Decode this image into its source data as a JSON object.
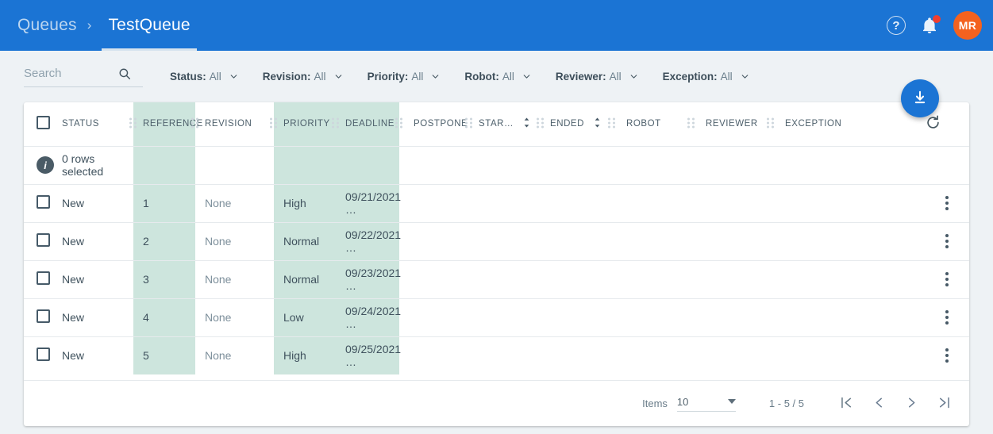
{
  "appbar": {
    "breadcrumb_root": "Queues",
    "breadcrumb_separator": "›",
    "breadcrumb_active": "TestQueue",
    "help_label": "?",
    "avatar_initials": "MR",
    "brand_color": "#1b74d4",
    "avatar_color": "#f4621f",
    "badge_color": "#f03e2f"
  },
  "filters": {
    "search_placeholder": "Search",
    "search_value": "",
    "items": [
      {
        "label": "Status:",
        "value": "All"
      },
      {
        "label": "Revision:",
        "value": "All"
      },
      {
        "label": "Priority:",
        "value": "All"
      },
      {
        "label": "Robot:",
        "value": "All"
      },
      {
        "label": "Reviewer:",
        "value": "All"
      },
      {
        "label": "Exception:",
        "value": "All"
      }
    ]
  },
  "table": {
    "highlight_color": "#cde5dd",
    "columns": [
      {
        "key": "status",
        "label": "STATUS",
        "highlight": false,
        "sortable": false
      },
      {
        "key": "reference",
        "label": "REFERENCE",
        "highlight": true,
        "sortable": false
      },
      {
        "key": "revision",
        "label": "REVISION",
        "highlight": false,
        "sortable": false
      },
      {
        "key": "priority",
        "label": "PRIORITY",
        "highlight": true,
        "sortable": false
      },
      {
        "key": "deadline",
        "label": "DEADLINE",
        "highlight": true,
        "sortable": false
      },
      {
        "key": "postpone",
        "label": "POSTPONE",
        "highlight": false,
        "sortable": false
      },
      {
        "key": "started",
        "label": "STAR…",
        "highlight": false,
        "sortable": true
      },
      {
        "key": "ended",
        "label": "ENDED",
        "highlight": false,
        "sortable": true
      },
      {
        "key": "robot",
        "label": "ROBOT",
        "highlight": false,
        "sortable": false
      },
      {
        "key": "reviewer",
        "label": "REVIEWER",
        "highlight": false,
        "sortable": false
      },
      {
        "key": "exception",
        "label": "EXCEPTION",
        "highlight": false,
        "sortable": false
      }
    ],
    "selection_info": "0 rows selected",
    "rows": [
      {
        "status": "New",
        "reference": "1",
        "revision": "None",
        "priority": "High",
        "deadline": "09/21/2021 …",
        "postpone": "",
        "started": "",
        "ended": "",
        "robot": "",
        "reviewer": "",
        "exception": ""
      },
      {
        "status": "New",
        "reference": "2",
        "revision": "None",
        "priority": "Normal",
        "deadline": "09/22/2021 …",
        "postpone": "",
        "started": "",
        "ended": "",
        "robot": "",
        "reviewer": "",
        "exception": ""
      },
      {
        "status": "New",
        "reference": "3",
        "revision": "None",
        "priority": "Normal",
        "deadline": "09/23/2021 …",
        "postpone": "",
        "started": "",
        "ended": "",
        "robot": "",
        "reviewer": "",
        "exception": ""
      },
      {
        "status": "New",
        "reference": "4",
        "revision": "None",
        "priority": "Low",
        "deadline": "09/24/2021 …",
        "postpone": "",
        "started": "",
        "ended": "",
        "robot": "",
        "reviewer": "",
        "exception": ""
      },
      {
        "status": "New",
        "reference": "5",
        "revision": "None",
        "priority": "High",
        "deadline": "09/25/2021 …",
        "postpone": "",
        "started": "",
        "ended": "",
        "robot": "",
        "reviewer": "",
        "exception": ""
      }
    ]
  },
  "paginator": {
    "items_label": "Items",
    "items_per_page": "10",
    "range_label": "1 - 5 / 5"
  },
  "icons": {
    "search": "search-icon",
    "download": "download-icon",
    "refresh": "refresh-icon",
    "bell": "bell-icon",
    "row_menu": "kebab-menu-icon"
  }
}
